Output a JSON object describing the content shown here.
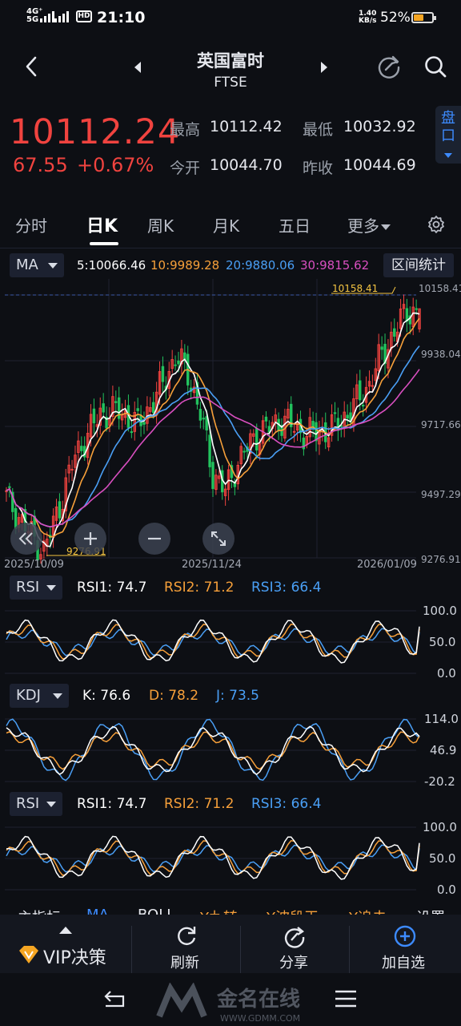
{
  "status": {
    "net_top": "4G⁺",
    "net_bottom": "5G",
    "hd": "HD",
    "time": "21:10",
    "speed_value": "1.40",
    "speed_unit": "KB/s",
    "battery": "52%",
    "battery_level": 0.52
  },
  "header": {
    "title": "英国富时",
    "subtitle": "FTSE"
  },
  "quote": {
    "price": "10112.24",
    "change": "67.55",
    "change_pct": "+0.67%",
    "high_label": "最高",
    "high": "10112.42",
    "low_label": "最低",
    "low": "10032.92",
    "open_label": "今开",
    "open": "10044.70",
    "prev_label": "昨收",
    "prev": "10044.69",
    "pankou": "盘口"
  },
  "tabs": [
    "分时",
    "日K",
    "周K",
    "月K",
    "五日",
    "更多"
  ],
  "ma": {
    "selector": "MA",
    "ma5": "5:10066.46",
    "ma10": "10:9989.28",
    "ma20": "20:9880.06",
    "ma30": "30:9815.62",
    "range_btn": "区间统计"
  },
  "price_axis": [
    "10158.41",
    "9938.04",
    "9717.66",
    "9497.29",
    "9276.91"
  ],
  "annotations": {
    "max": "10158.41",
    "min": "9276.91"
  },
  "dates": [
    "2025/10/09",
    "2025/11/24",
    "2026/01/09"
  ],
  "rsi1": {
    "selector": "RSI",
    "v1": "RSI1: 74.7",
    "v2": "RSI2: 71.2",
    "v3": "RSI3: 66.4",
    "axis": [
      "100.0",
      "50.0",
      "0.0"
    ]
  },
  "kdj": {
    "selector": "KDJ",
    "k": "K: 76.6",
    "d": "D: 78.2",
    "j": "J: 73.5",
    "axis": [
      "114.0",
      "46.9",
      "-20.2"
    ]
  },
  "rsi2": {
    "selector": "RSI",
    "v1": "RSI1: 74.7",
    "v2": "RSI2: 71.2",
    "v3": "RSI3: 66.4",
    "axis": [
      "100.0",
      "50.0",
      "0.0"
    ]
  },
  "indicator_tabs": [
    "主指标",
    "MA",
    "BOLL",
    "Y九转",
    "Y波段王",
    "Y追击",
    "设置"
  ],
  "bottom": {
    "vip": "VIP决策",
    "refresh": "刷新",
    "share": "分享",
    "add": "加自选"
  },
  "watermark": {
    "cn": "金名在线",
    "url": "WWW.GDMM.COM"
  },
  "colors": {
    "up": "#f0433f",
    "down": "#22c35e",
    "ma5": "#ffffff",
    "ma10": "#f7a03a",
    "ma20": "#4a9ff5",
    "ma30": "#d94fc0",
    "accent": "#3d8bff"
  },
  "chart_data": {
    "type": "candlestick",
    "ylim": [
      9276.91,
      10158.41
    ],
    "x_labels": [
      "2025/10/09",
      "2025/11/24",
      "2026/01/09"
    ],
    "last": {
      "open": 10044.7,
      "high": 10112.42,
      "low": 10032.92,
      "close": 10112.24
    },
    "ma": {
      "MA5": 10066.46,
      "MA10": 9989.28,
      "MA20": 9880.06,
      "MA30": 9815.62
    },
    "max": 10158.41,
    "min": 9276.91,
    "rsi": {
      "RSI1": 74.7,
      "RSI2": 71.2,
      "RSI3": 66.4,
      "ylim": [
        0,
        100
      ]
    },
    "kdj": {
      "K": 76.6,
      "D": 78.2,
      "J": 73.5,
      "ylim": [
        -20.2,
        114.0
      ]
    }
  }
}
